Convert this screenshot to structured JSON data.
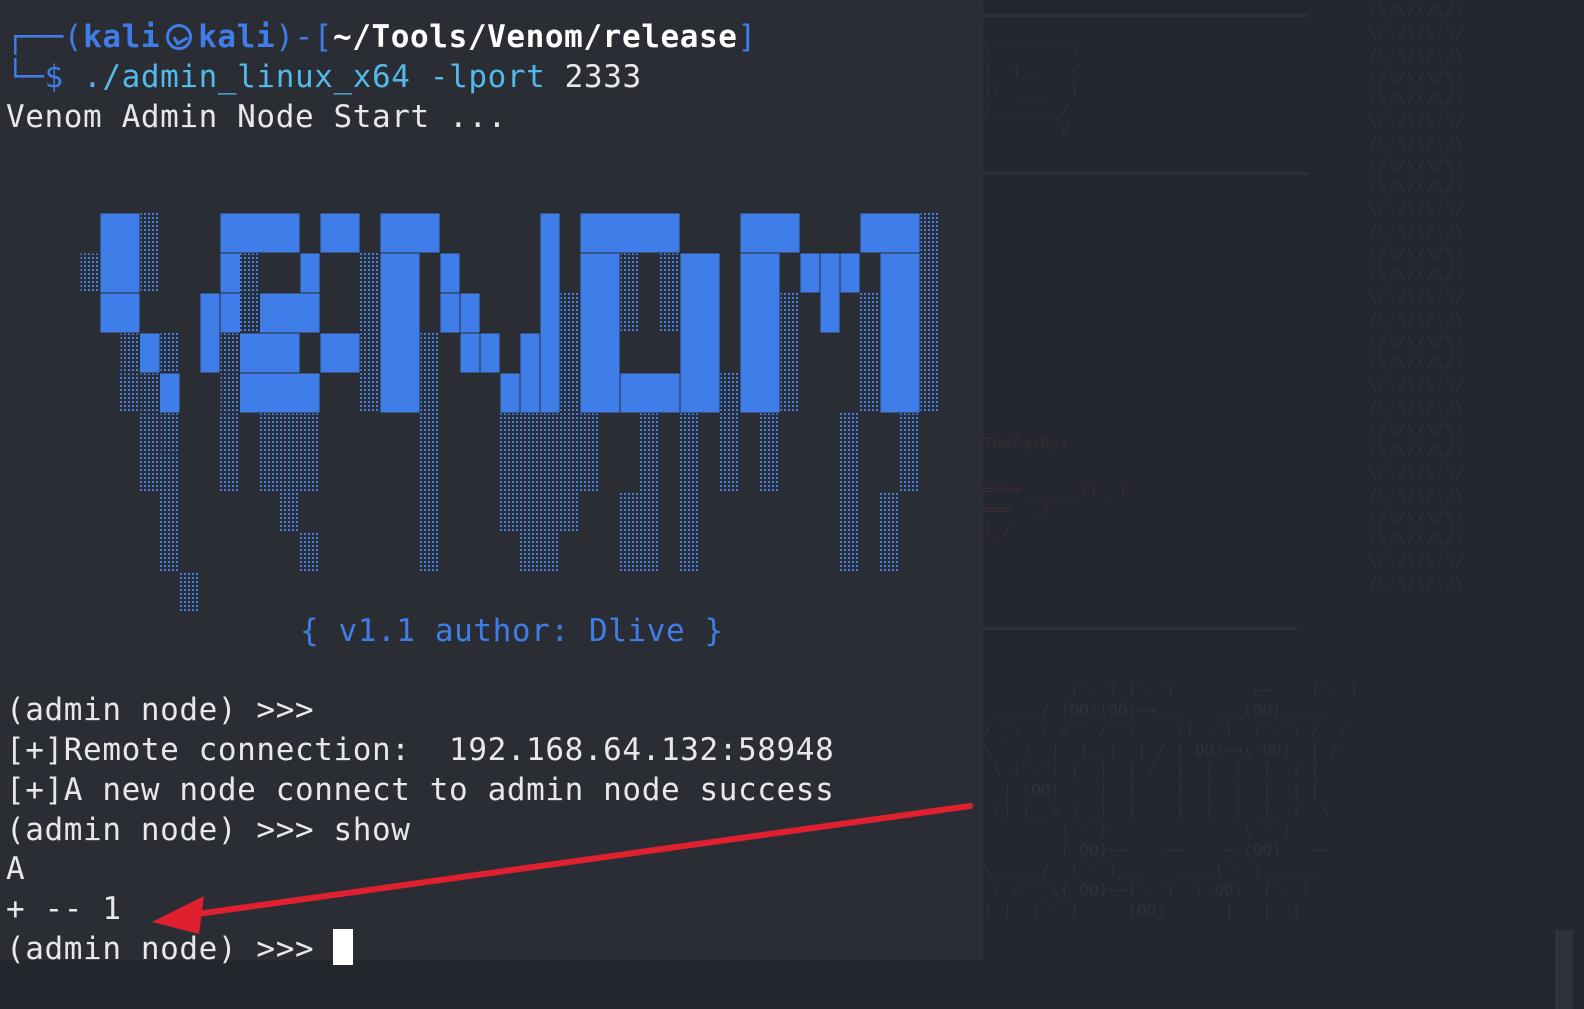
{
  "terminal": {
    "prompt_open": "┌──(",
    "user": "kali",
    "host": "kali",
    "prompt_mid": ")-[",
    "path": "~/Tools/Venom/release",
    "prompt_close": "]",
    "prompt_dollar": "└─$",
    "command": "./admin_linux_x64",
    "command_flag": " -lport",
    "command_arg": " 2333",
    "output_start": "Venom Admin Node Start ...",
    "version": "{ v1.1 author: Dlive }",
    "lines": [
      "(admin node) >>>",
      "[+]Remote connection:  192.168.64.132:58948",
      "[+]A new node connect to admin node success",
      "(admin node) >>> show",
      "A",
      "+ -- 1",
      "(admin node) >>> "
    ]
  },
  "background": {
    "blurred_label": "TheFatRat"
  },
  "colors": {
    "terminal_bg": "#2b2d35",
    "accent_blue": "#3f7ee8",
    "command_cyan": "#52b9e8",
    "arrow_red": "#e0202e"
  }
}
